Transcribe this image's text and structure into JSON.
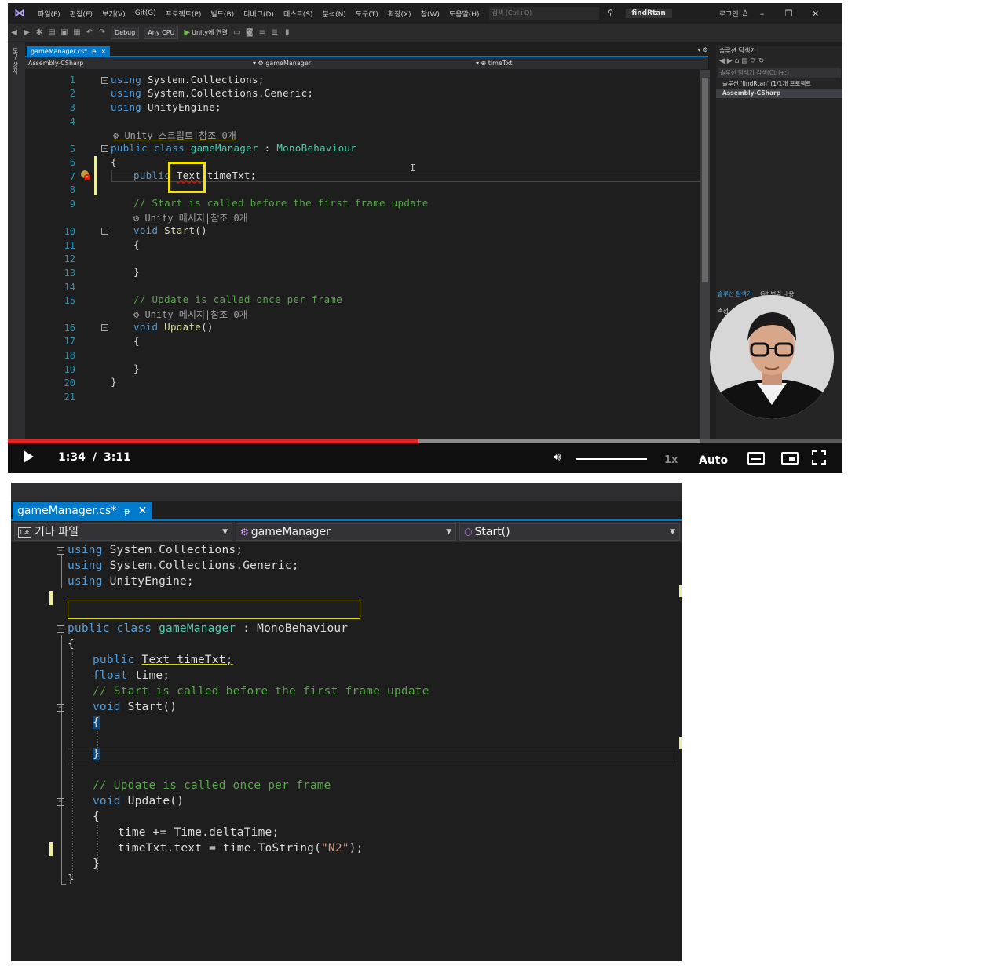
{
  "video": {
    "menu": [
      "파일(F)",
      "편집(E)",
      "보기(V)",
      "Git(G)",
      "프로젝트(P)",
      "빌드(B)",
      "디버그(D)",
      "테스트(S)",
      "분석(N)",
      "도구(T)",
      "확장(X)",
      "창(W)",
      "도움말(H)"
    ],
    "search_placeholder": "검색 (Ctrl+Q)",
    "solution_name": "findRtan",
    "login_label": "로그인",
    "toolbar": {
      "config": "Debug",
      "platform": "Any CPU",
      "run_label": "Unity에 연결"
    },
    "left_strip_label": "도구 상자",
    "tab": {
      "file": "gameManager.cs*",
      "pin": "ᵽ",
      "close": "×"
    },
    "nav": {
      "project": "Assembly-CSharp",
      "class": "gameManager",
      "member": "timeTxt"
    },
    "line_numbers": [
      "1",
      "2",
      "3",
      "4",
      "5",
      "6",
      "7",
      "8",
      "9",
      "10",
      "11",
      "12",
      "13",
      "14",
      "15",
      "16",
      "17",
      "18",
      "19",
      "20",
      "21"
    ],
    "code": {
      "l1_kw": "using",
      "l1_ns": " System.Collections;",
      "l2_kw": "using",
      "l2_ns": " System.Collections.Generic;",
      "l3_kw": "using",
      "l3_ns": " UnityEngine;",
      "lens1": "Unity 스크립트|참조 0개",
      "l5_kw": "public class",
      "l5_cls": "gameManager",
      "l5_colon": " : ",
      "l5_base": "MonoBehaviour",
      "l6": "{",
      "l7_kw": "public",
      "l7_type": "Text",
      "l7_rest": " timeTxt;",
      "l9_cm": "// Start is called before the first frame update",
      "lens2": "Unity 메시지|참조 0개",
      "l10_kw": "void",
      "l10_name": "Start",
      "l10_rest": "()",
      "l11": "{",
      "l13": "}",
      "l15_cm": "// Update is called once per frame",
      "lens3": "Unity 메시지|참조 0개",
      "l16_kw": "void",
      "l16_name": "Update",
      "l16_rest": "()",
      "l17": "{",
      "l19": "}",
      "l20": "}"
    },
    "solution_explorer": {
      "title": "솔루션 탐색기",
      "search": "솔루션 탐색기 검색(Ctrl+;)",
      "solution_item": "솔루션 'findRtan' (1/1개 프로젝트",
      "project_item": "Assembly-CSharp",
      "bottom_tab_1": "솔루션 탐색기",
      "bottom_tab_2": "Git 변경 내용",
      "properties_label": "속성"
    },
    "player": {
      "current_time": "1:34",
      "separator": "/",
      "duration": "3:11",
      "progress_fraction": 0.492,
      "buffered_fraction": 0.83,
      "volume_fraction": 1.0,
      "speed": "1x",
      "quality": "Auto"
    }
  },
  "editor": {
    "tab": {
      "file": "gameManager.cs*",
      "pin": "ᵽ",
      "close": "✕"
    },
    "nav": {
      "project": "기타 파일",
      "class": "gameManager",
      "member": "Start()"
    },
    "code": {
      "l1_kw": "using",
      "l1_ns": " System.Collections;",
      "l2_kw": "using",
      "l2_ns": " System.Collections.Generic;",
      "l3_kw": "using",
      "l3_ns": " UnityEngine;",
      "l5_kw": "public class",
      "l5_cls": "gameManager",
      "l5_colon": " : ",
      "l5_base": "MonoBehaviour",
      "l6": "{",
      "l7_kw": "public",
      "l7_type": "Text",
      "l7_rest": " timeTxt;",
      "l8_kw": "float",
      "l8_rest": " time;",
      "l9_cm": "// Start is called before the first frame update",
      "l10_kw": "void",
      "l10_name": "Start",
      "l10_rest": "()",
      "l11": "{",
      "l13": "}",
      "l15_cm": "// Update is called once per frame",
      "l16_kw": "void",
      "l16_name": "Update",
      "l16_rest": "()",
      "l17": "{",
      "l18": "time += Time.deltaTime;",
      "l19_a": "timeTxt.text = time.",
      "l19_m": "ToString",
      "l19_b": "(",
      "l19_s": "\"N2\"",
      "l19_c": ");",
      "l20": "}",
      "l21": "}"
    }
  }
}
